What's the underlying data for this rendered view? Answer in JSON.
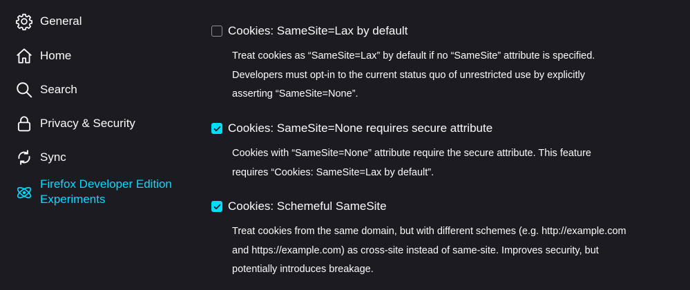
{
  "sidebar": {
    "items": [
      {
        "label": "General",
        "icon": "gear-icon"
      },
      {
        "label": "Home",
        "icon": "home-icon"
      },
      {
        "label": "Search",
        "icon": "search-icon"
      },
      {
        "label": "Privacy & Security",
        "icon": "lock-icon"
      },
      {
        "label": "Sync",
        "icon": "sync-icon"
      },
      {
        "label": "Firefox Developer Edition Experiments",
        "label_line1": "Firefox Developer Edition",
        "label_line2": "Experiments",
        "icon": "experiments-icon",
        "active": true
      }
    ]
  },
  "colors": {
    "background": "#1c1b22",
    "text": "#fbfbfe",
    "accent": "#00ddff",
    "checkbox_border": "#8f8f9d"
  },
  "prefs": [
    {
      "title": "Cookies: SameSite=Lax by default",
      "checked": false,
      "desc_lines": [
        "Treat cookies as “SameSite=Lax” by default if no “SameSite” attribute is specified.",
        "Developers must opt-in to the current status quo of unrestricted use by explicitly",
        "asserting “SameSite=None”."
      ]
    },
    {
      "title": "Cookies: SameSite=None requires secure attribute",
      "checked": true,
      "desc_lines": [
        "Cookies with “SameSite=None” attribute require the secure attribute. This feature",
        "requires “Cookies: SameSite=Lax by default”."
      ]
    },
    {
      "title": "Cookies: Schemeful SameSite",
      "checked": true,
      "desc_lines": [
        "Treat cookies from the same domain, but with different schemes (e.g. http://example.com",
        "and https://example.com) as cross-site instead of same-site. Improves security, but",
        "potentially introduces breakage."
      ]
    }
  ]
}
